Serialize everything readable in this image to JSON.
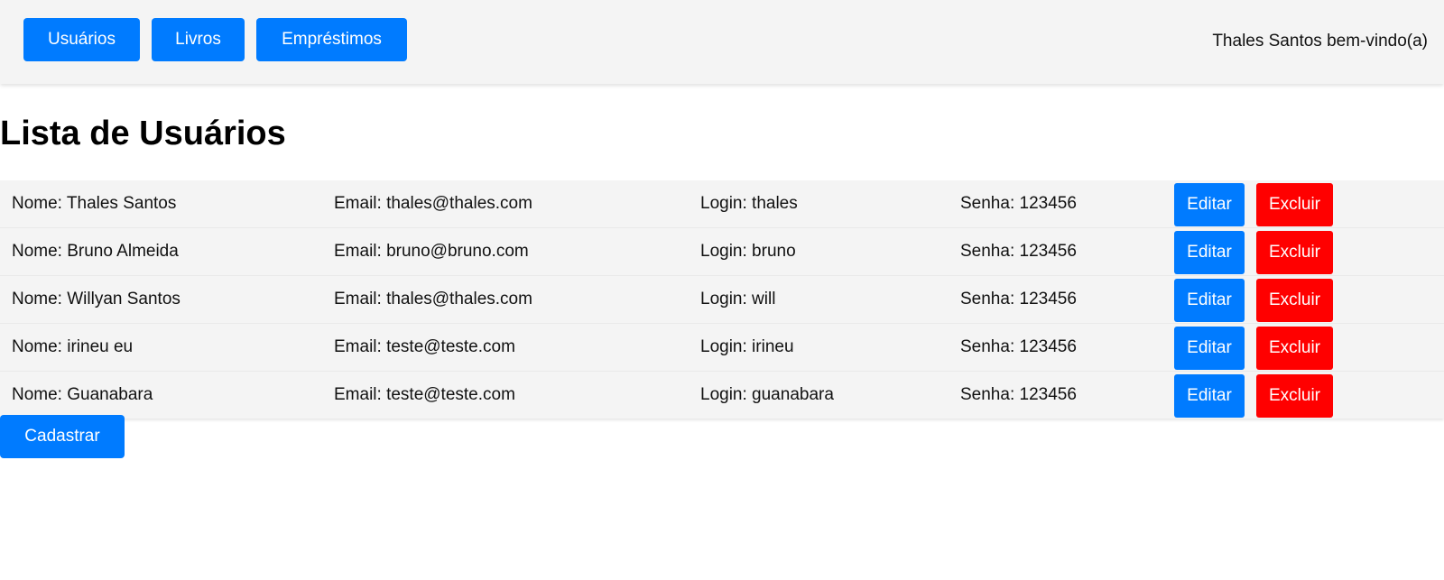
{
  "nav": {
    "users_label": "Usuários",
    "books_label": "Livros",
    "loans_label": "Empréstimos"
  },
  "welcome_text": "Thales Santos bem-vindo(a)",
  "page_title": "Lista de Usuários",
  "users": [
    {
      "name": "Nome: Thales Santos",
      "email": "Email: thales@thales.com",
      "login": "Login: thales",
      "password": "Senha: 123456"
    },
    {
      "name": "Nome: Bruno Almeida",
      "email": "Email: bruno@bruno.com",
      "login": "Login: bruno",
      "password": "Senha: 123456"
    },
    {
      "name": "Nome: Willyan Santos",
      "email": "Email: thales@thales.com",
      "login": "Login: will",
      "password": "Senha: 123456"
    },
    {
      "name": "Nome: irineu eu",
      "email": "Email: teste@teste.com",
      "login": "Login: irineu",
      "password": "Senha: 123456"
    },
    {
      "name": "Nome: Guanabara",
      "email": "Email: teste@teste.com",
      "login": "Login: guanabara",
      "password": "Senha: 123456"
    }
  ],
  "actions": {
    "edit_label": "Editar",
    "delete_label": "Excluir"
  },
  "register_label": "Cadastrar",
  "colors": {
    "primary": "#007bff",
    "danger": "#ff0000",
    "header_bg": "#f4f4f4",
    "row_bg": "#f4f4f4"
  }
}
